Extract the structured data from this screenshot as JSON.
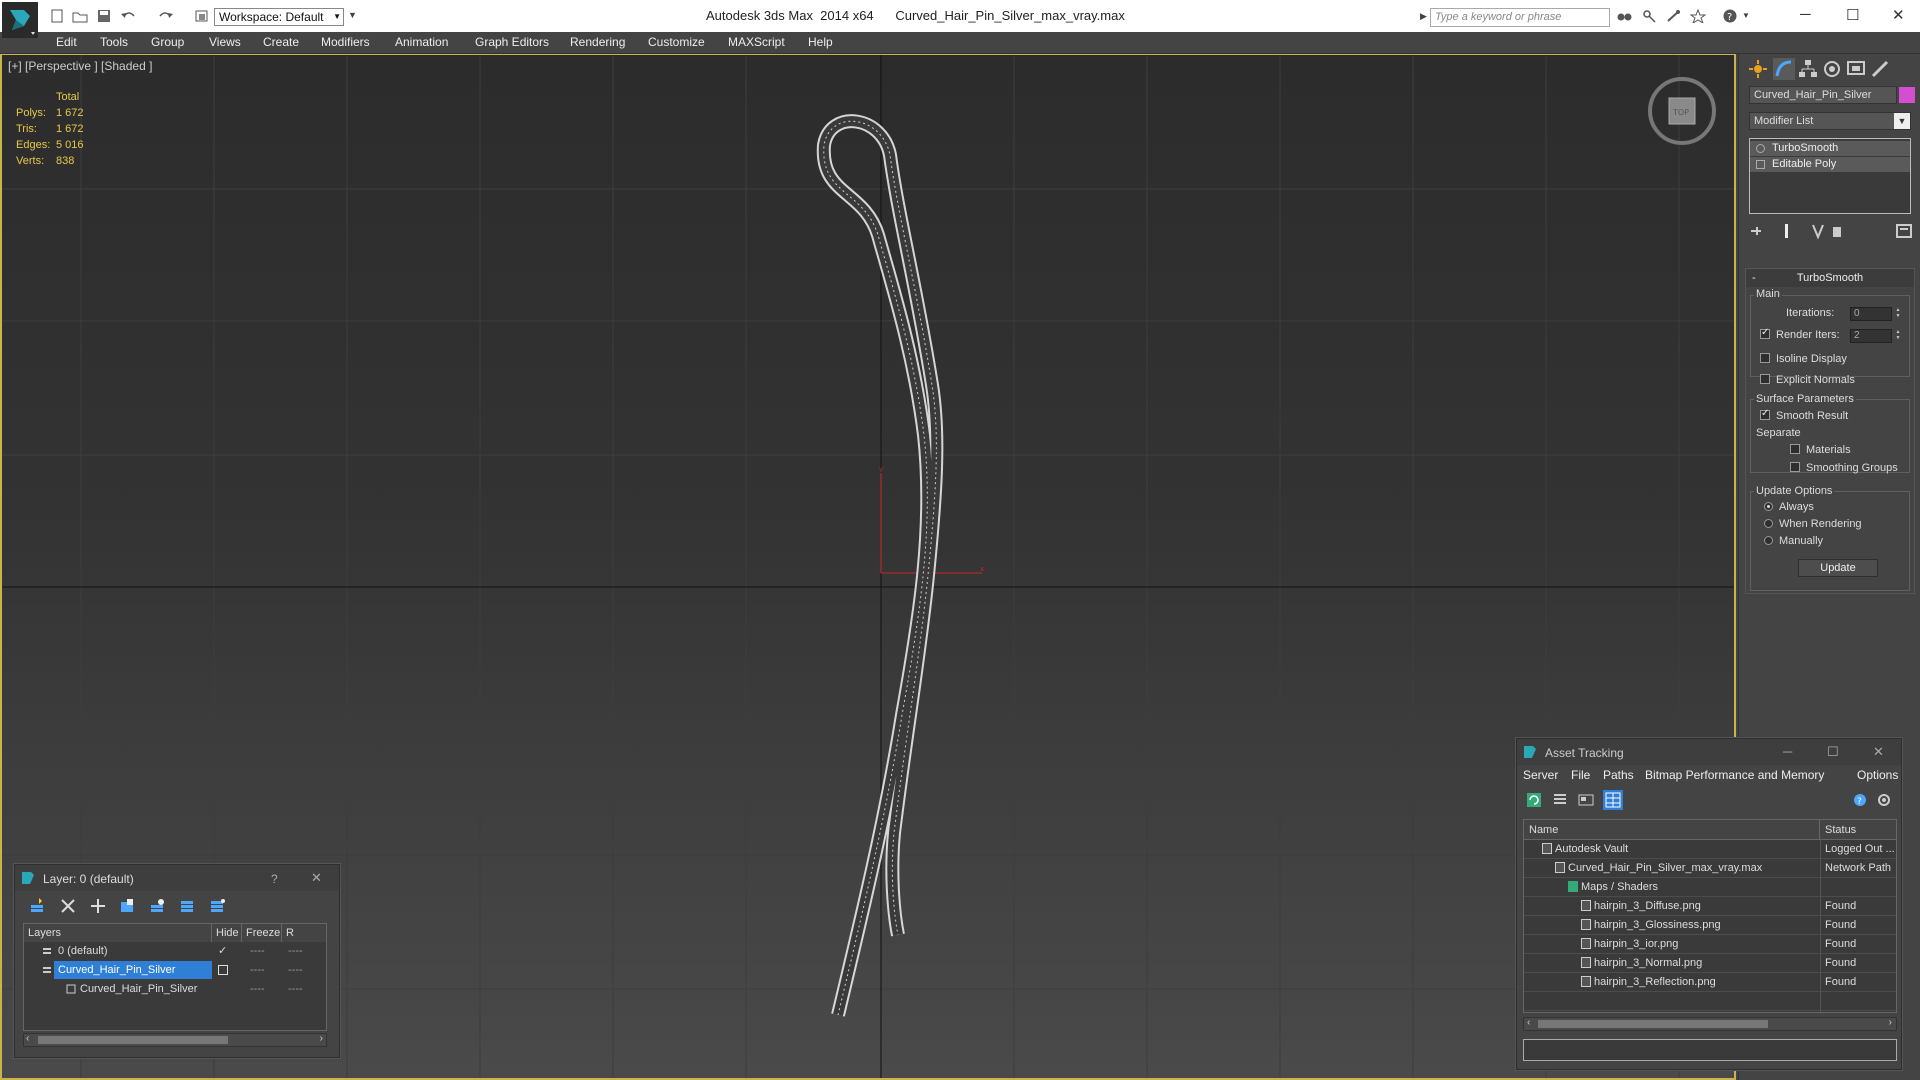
{
  "titlebar": {
    "workspace": "Workspace: Default",
    "app_title": "Autodesk 3ds Max  2014 x64",
    "file_title": "Curved_Hair_Pin_Silver_max_vray.max",
    "search_placeholder": "Type a keyword or phrase",
    "minimize": "─",
    "maximize": "☐",
    "close": "✕"
  },
  "menu": [
    "Edit",
    "Tools",
    "Group",
    "Views",
    "Create",
    "Modifiers",
    "Animation",
    "Graph Editors",
    "Rendering",
    "Customize",
    "MAXScript",
    "Help"
  ],
  "viewport": {
    "label": "[+] [Perspective ] [Shaded ]",
    "stats": {
      "header": "Total",
      "rows": [
        {
          "k": "Polys:",
          "v": "1 672"
        },
        {
          "k": "Tris:",
          "v": "1 672"
        },
        {
          "k": "Edges:",
          "v": "5 016"
        },
        {
          "k": "Verts:",
          "v": "838"
        }
      ]
    },
    "viewcube_label": "TOP"
  },
  "command_panel": {
    "object_name": "Curved_Hair_Pin_Silver",
    "object_color": "#d34fd0",
    "modifier_list": "Modifier List",
    "stack": [
      "TurboSmooth",
      "Editable Poly"
    ],
    "rollout": {
      "title": "TurboSmooth",
      "collapse": "-",
      "main_label": "Main",
      "iterations_label": "Iterations:",
      "iterations_value": "0",
      "render_iters_label": "Render Iters:",
      "render_iters_value": "2",
      "isoline": "Isoline Display",
      "explicit": "Explicit Normals",
      "surface_label": "Surface Parameters",
      "smooth": "Smooth Result",
      "separate": "Separate",
      "materials": "Materials",
      "smoothing_groups": "Smoothing Groups",
      "update_options": "Update Options",
      "always": "Always",
      "when_rendering": "When Rendering",
      "manually": "Manually",
      "update_button": "Update"
    }
  },
  "layer_dialog": {
    "title": "Layer: 0 (default)",
    "help": "?",
    "close": "✕",
    "columns": [
      "Layers",
      "Hide",
      "Freeze",
      "R"
    ],
    "rows": [
      {
        "name": "0 (default)",
        "marker": "✓"
      },
      {
        "name": "Curved_Hair_Pin_Silver",
        "marker": ""
      },
      {
        "name": "Curved_Hair_Pin_Silver",
        "marker": ""
      }
    ],
    "dash": "----"
  },
  "asset_dialog": {
    "title": "Asset Tracking",
    "menu": [
      "Server",
      "File",
      "Paths",
      "Bitmap Performance and Memory",
      "Options"
    ],
    "columns": [
      "Name",
      "Status"
    ],
    "rows": [
      {
        "name": "Autodesk Vault",
        "status": "Logged Out ...",
        "indent": 0
      },
      {
        "name": "Curved_Hair_Pin_Silver_max_vray.max",
        "status": "Network Path",
        "indent": 1
      },
      {
        "name": "Maps / Shaders",
        "status": "",
        "indent": 2
      },
      {
        "name": "hairpin_3_Diffuse.png",
        "status": "Found",
        "indent": 3
      },
      {
        "name": "hairpin_3_Glossiness.png",
        "status": "Found",
        "indent": 3
      },
      {
        "name": "hairpin_3_ior.png",
        "status": "Found",
        "indent": 3
      },
      {
        "name": "hairpin_3_Normal.png",
        "status": "Found",
        "indent": 3
      },
      {
        "name": "hairpin_3_Reflection.png",
        "status": "Found",
        "indent": 3
      }
    ]
  },
  "colors": {
    "viewport_border": "#c8b44a",
    "stats_text": "#e8c84a",
    "selection": "#2f7fd6"
  }
}
